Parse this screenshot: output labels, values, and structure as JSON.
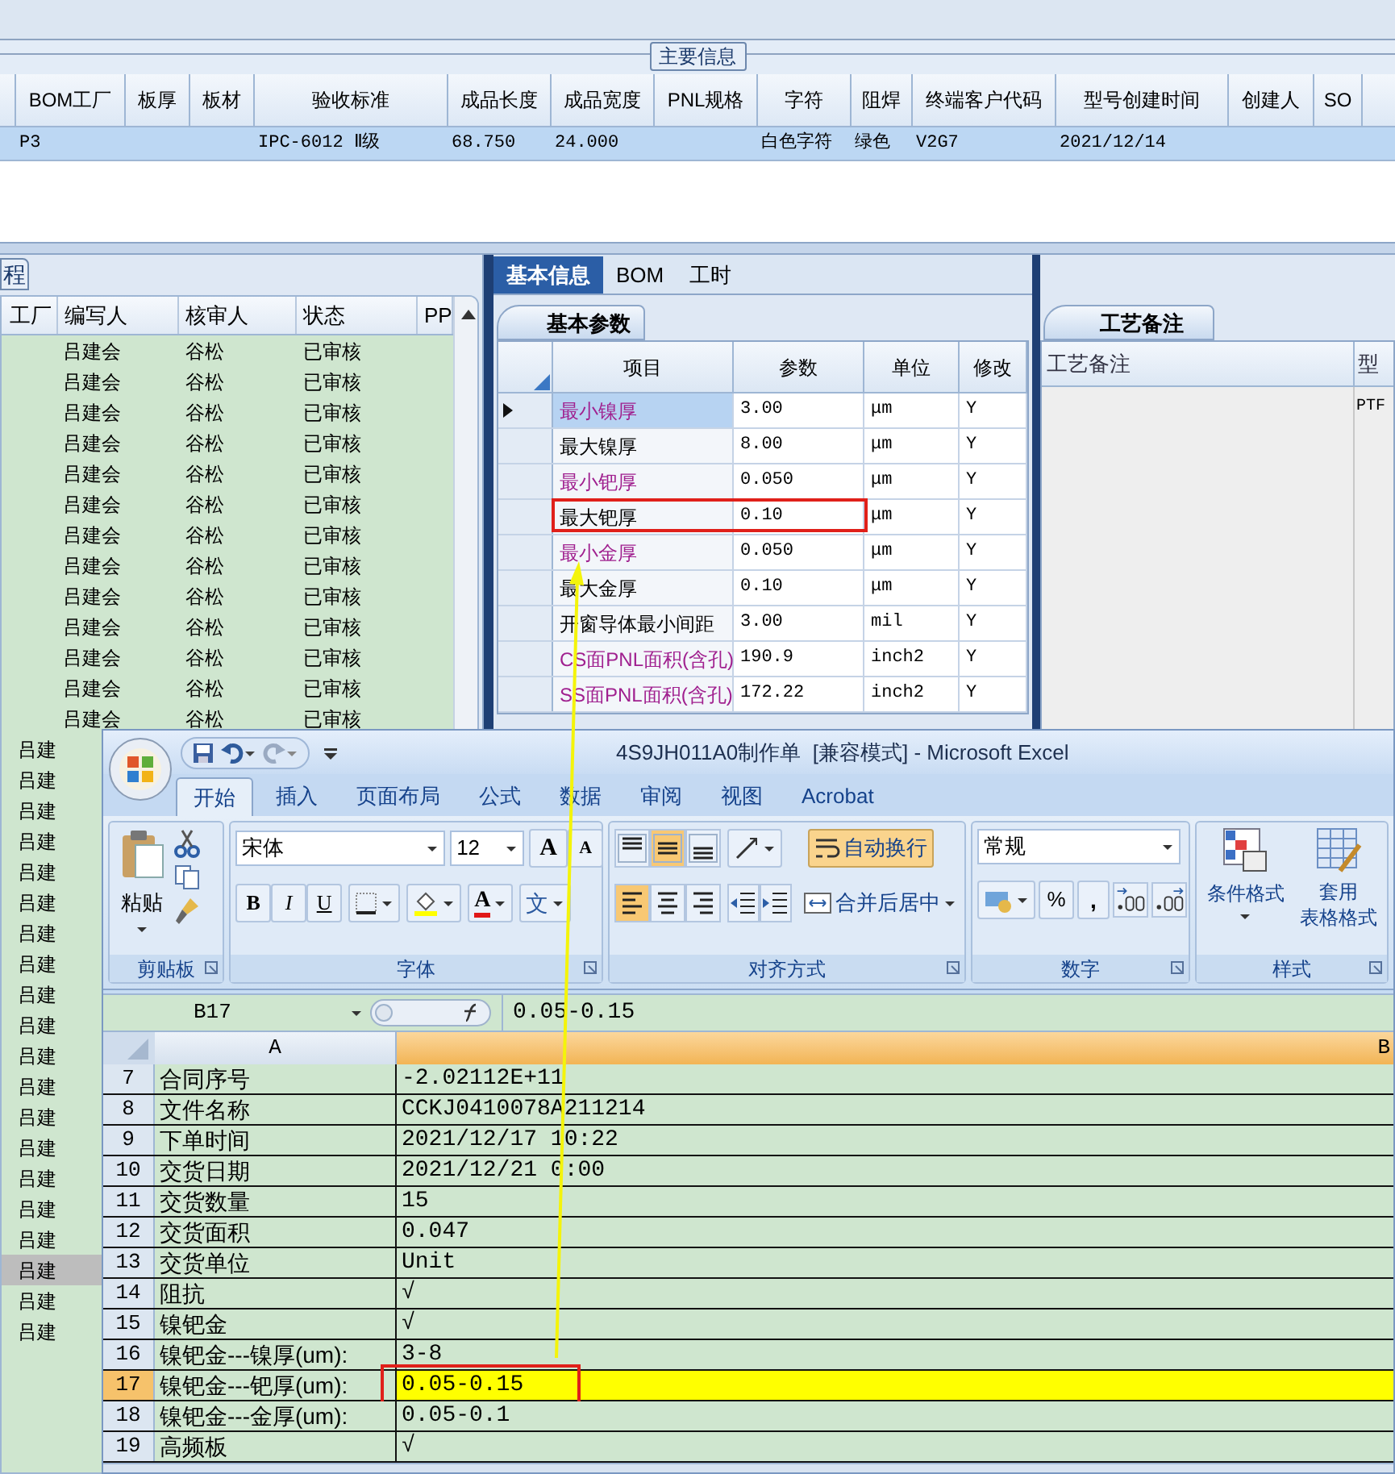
{
  "main_info": {
    "group_title": "主要信息",
    "columns": [
      "BOM工厂",
      "板厚",
      "板材",
      "验收标准",
      "成品长度",
      "成品宽度",
      "PNL规格",
      "字符",
      "阻焊",
      "终端客户代码",
      "型号创建时间",
      "创建人",
      "SO"
    ],
    "rows": [
      {
        "selected": true,
        "cells": [
          "P3",
          null,
          null,
          "IPC-6012 Ⅱ级",
          "68.750",
          "24.000",
          null,
          "白色字符",
          "绿色",
          "V2G7",
          "2021/12/14",
          null,
          null
        ]
      }
    ]
  },
  "flow_panel": {
    "tab": "程",
    "columns": [
      "工厂",
      "编写人",
      "核审人",
      "状态",
      "PP"
    ],
    "rows": [
      {
        "editor": "吕建会",
        "reviewer": "谷松",
        "status": "已审核",
        "selected": false
      },
      {
        "editor": "吕建会",
        "reviewer": "谷松",
        "status": "已审核",
        "selected": false
      },
      {
        "editor": "吕建会",
        "reviewer": "谷松",
        "status": "已审核",
        "selected": false
      },
      {
        "editor": "吕建会",
        "reviewer": "谷松",
        "status": "已审核",
        "selected": false
      },
      {
        "editor": "吕建会",
        "reviewer": "谷松",
        "status": "已审核",
        "selected": false
      },
      {
        "editor": "吕建会",
        "reviewer": "谷松",
        "status": "已审核",
        "selected": false
      },
      {
        "editor": "吕建会",
        "reviewer": "谷松",
        "status": "已审核",
        "selected": false
      },
      {
        "editor": "吕建会",
        "reviewer": "谷松",
        "status": "已审核",
        "selected": false
      },
      {
        "editor": "吕建会",
        "reviewer": "谷松",
        "status": "已审核",
        "selected": false
      },
      {
        "editor": "吕建会",
        "reviewer": "谷松",
        "status": "已审核",
        "selected": false
      },
      {
        "editor": "吕建会",
        "reviewer": "谷松",
        "status": "已审核",
        "selected": false
      },
      {
        "editor": "吕建会",
        "reviewer": "谷松",
        "status": "已审核",
        "selected": false
      },
      {
        "editor": "吕建会",
        "reviewer": "谷松",
        "status": "已审核",
        "selected": false
      },
      {
        "editor": "吕建",
        "selected": false
      },
      {
        "editor": "吕建",
        "selected": false
      },
      {
        "editor": "吕建",
        "selected": false
      },
      {
        "editor": "吕建",
        "selected": false
      },
      {
        "editor": "吕建",
        "selected": false
      },
      {
        "editor": "吕建",
        "selected": false
      },
      {
        "editor": "吕建",
        "selected": false
      },
      {
        "editor": "吕建",
        "selected": false
      },
      {
        "editor": "吕建",
        "selected": false
      },
      {
        "editor": "吕建",
        "selected": false
      },
      {
        "editor": "吕建",
        "selected": false
      },
      {
        "editor": "吕建",
        "selected": false
      },
      {
        "editor": "吕建",
        "selected": false
      },
      {
        "editor": "吕建",
        "selected": false
      },
      {
        "editor": "吕建",
        "selected": false
      },
      {
        "editor": "吕建",
        "selected": false
      },
      {
        "editor": "吕建",
        "selected": false
      },
      {
        "editor": "吕建",
        "selected": true
      },
      {
        "editor": "吕建",
        "selected": false
      },
      {
        "editor": "吕建",
        "selected": false
      }
    ]
  },
  "detail_panel": {
    "tabs": [
      {
        "label": "基本信息",
        "selected": true
      },
      {
        "label": "BOM",
        "selected": false
      },
      {
        "label": "工时",
        "selected": false
      }
    ],
    "section_tab": "基本参数",
    "columns": [
      "项目",
      "参数",
      "单位",
      "修改"
    ],
    "rows": [
      {
        "name": "最小镍厚",
        "value": "3.00",
        "unit": "μm",
        "modified": "Y",
        "emphasized": true,
        "selected": true,
        "marked": false
      },
      {
        "name": "最大镍厚",
        "value": "8.00",
        "unit": "μm",
        "modified": "Y",
        "emphasized": false,
        "selected": false,
        "marked": false
      },
      {
        "name": "最小钯厚",
        "value": "0.050",
        "unit": "μm",
        "modified": "Y",
        "emphasized": true,
        "selected": false,
        "marked": false
      },
      {
        "name": "最大钯厚",
        "value": "0.10",
        "unit": "μm",
        "modified": "Y",
        "emphasized": false,
        "selected": false,
        "marked": true
      },
      {
        "name": "最小金厚",
        "value": "0.050",
        "unit": "μm",
        "modified": "Y",
        "emphasized": true,
        "selected": false,
        "marked": false
      },
      {
        "name": "最大金厚",
        "value": "0.10",
        "unit": "μm",
        "modified": "Y",
        "emphasized": false,
        "selected": false,
        "marked": false
      },
      {
        "name": "开窗导体最小间距",
        "value": "3.00",
        "unit": "mil",
        "modified": "Y",
        "emphasized": false,
        "selected": false,
        "marked": false
      },
      {
        "name": "CS面PNL面积(含孔)",
        "value": "190.9",
        "unit": "inch2",
        "modified": "Y",
        "emphasized": true,
        "selected": false,
        "marked": false
      },
      {
        "name": "SS面PNL面积(含孔)",
        "value": "172.22",
        "unit": "inch2",
        "modified": "Y",
        "emphasized": true,
        "selected": false,
        "marked": false
      }
    ]
  },
  "remarks_panel": {
    "tab": "工艺备注",
    "columns": [
      "工艺备注",
      "型"
    ],
    "cell": "PTF"
  },
  "excel": {
    "title": "4S9JH011A0制作单  [兼容模式] - Microsoft Excel",
    "tabs": [
      {
        "label": "开始",
        "selected": true
      },
      {
        "label": "插入",
        "selected": false
      },
      {
        "label": "页面布局",
        "selected": false
      },
      {
        "label": "公式",
        "selected": false
      },
      {
        "label": "数据",
        "selected": false
      },
      {
        "label": "审阅",
        "selected": false
      },
      {
        "label": "视图",
        "selected": false
      },
      {
        "label": "Acrobat",
        "selected": false
      }
    ],
    "clipboard": {
      "paste": "粘贴",
      "group": "剪贴板"
    },
    "font": {
      "name": "宋体",
      "size": "12",
      "grow": "A",
      "shrink": "A",
      "bold": "B",
      "italic": "I",
      "underline": "U",
      "color_button": "A",
      "phonetic": "文",
      "group": "字体"
    },
    "alignment": {
      "wrap": {
        "label": "自动换行",
        "on": true
      },
      "merge": "合并后居中",
      "middle_align_on": true,
      "left_align_on": true,
      "group": "对齐方式"
    },
    "number": {
      "format": "常规",
      "percent": "%",
      "comma": ",",
      "group": "数字"
    },
    "styles": {
      "conditional": "条件格式",
      "table_lines": [
        "套用",
        "表格格式"
      ],
      "group": "样式"
    },
    "name_box": "B17",
    "formula": "0.05-0.15",
    "columns": [
      "A",
      "B"
    ],
    "rows": [
      {
        "number": "7",
        "a": "合同序号",
        "b": "-2.02112E+11",
        "selected": false,
        "filled": false,
        "marked": false
      },
      {
        "number": "8",
        "a": "文件名称",
        "b": "CCKJ0410078A211214",
        "selected": false,
        "filled": false,
        "marked": false
      },
      {
        "number": "9",
        "a": "下单时间",
        "b": "2021/12/17 10:22",
        "selected": false,
        "filled": false,
        "marked": false
      },
      {
        "number": "10",
        "a": "交货日期",
        "b": "2021/12/21 0:00",
        "selected": false,
        "filled": false,
        "marked": false
      },
      {
        "number": "11",
        "a": "交货数量",
        "b": "15",
        "selected": false,
        "filled": false,
        "marked": false
      },
      {
        "number": "12",
        "a": "交货面积",
        "b": "0.047",
        "selected": false,
        "filled": false,
        "marked": false
      },
      {
        "number": "13",
        "a": "交货单位",
        "b": "Unit",
        "selected": false,
        "filled": false,
        "marked": false
      },
      {
        "number": "14",
        "a": "阻抗",
        "b": "√",
        "selected": false,
        "filled": false,
        "marked": false
      },
      {
        "number": "15",
        "a": "镍钯金",
        "b": "√",
        "selected": false,
        "filled": false,
        "marked": false
      },
      {
        "number": "16",
        "a": "镍钯金---镍厚(um):",
        "b": "3-8",
        "selected": false,
        "filled": false,
        "marked": false
      },
      {
        "number": "17",
        "a": "镍钯金---钯厚(um):",
        "b": "0.05-0.15",
        "selected": true,
        "filled": true,
        "marked": true
      },
      {
        "number": "18",
        "a": "镍钯金---金厚(um):",
        "b": "0.05-0.1",
        "selected": false,
        "filled": false,
        "marked": false
      },
      {
        "number": "19",
        "a": "高频板",
        "b": "√",
        "selected": false,
        "filled": false,
        "marked": false
      }
    ]
  }
}
